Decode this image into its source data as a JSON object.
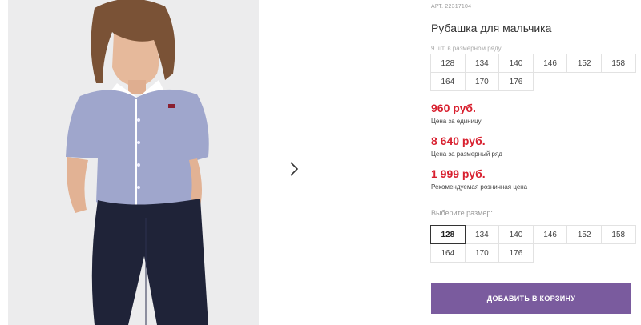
{
  "product": {
    "sku": "АРТ. 22317104",
    "title": "Рубашка для мальчика",
    "row_note": "9 шт. в размерном ряду",
    "size_row": [
      "128",
      "134",
      "140",
      "146",
      "152",
      "158",
      "164",
      "170",
      "176"
    ]
  },
  "prices": {
    "unit_price": "960 руб.",
    "unit_label": "Цена за единицу",
    "row_price": "8 640 руб.",
    "row_label": "Цена за размерный ряд",
    "retail_price": "1 999 руб.",
    "retail_label": "Рекомендуемая розничная цена",
    "price_color": "#d8202f"
  },
  "size_select": {
    "hint": "Выберите размер:",
    "options": [
      "128",
      "134",
      "140",
      "146",
      "152",
      "158",
      "164",
      "170",
      "176"
    ],
    "selected": "128"
  },
  "cart": {
    "button_label": "ДОБАВИТЬ В КОРЗИНУ",
    "button_color": "#7a5b9e"
  },
  "gallery": {
    "next_icon": "chevron-right-icon"
  }
}
